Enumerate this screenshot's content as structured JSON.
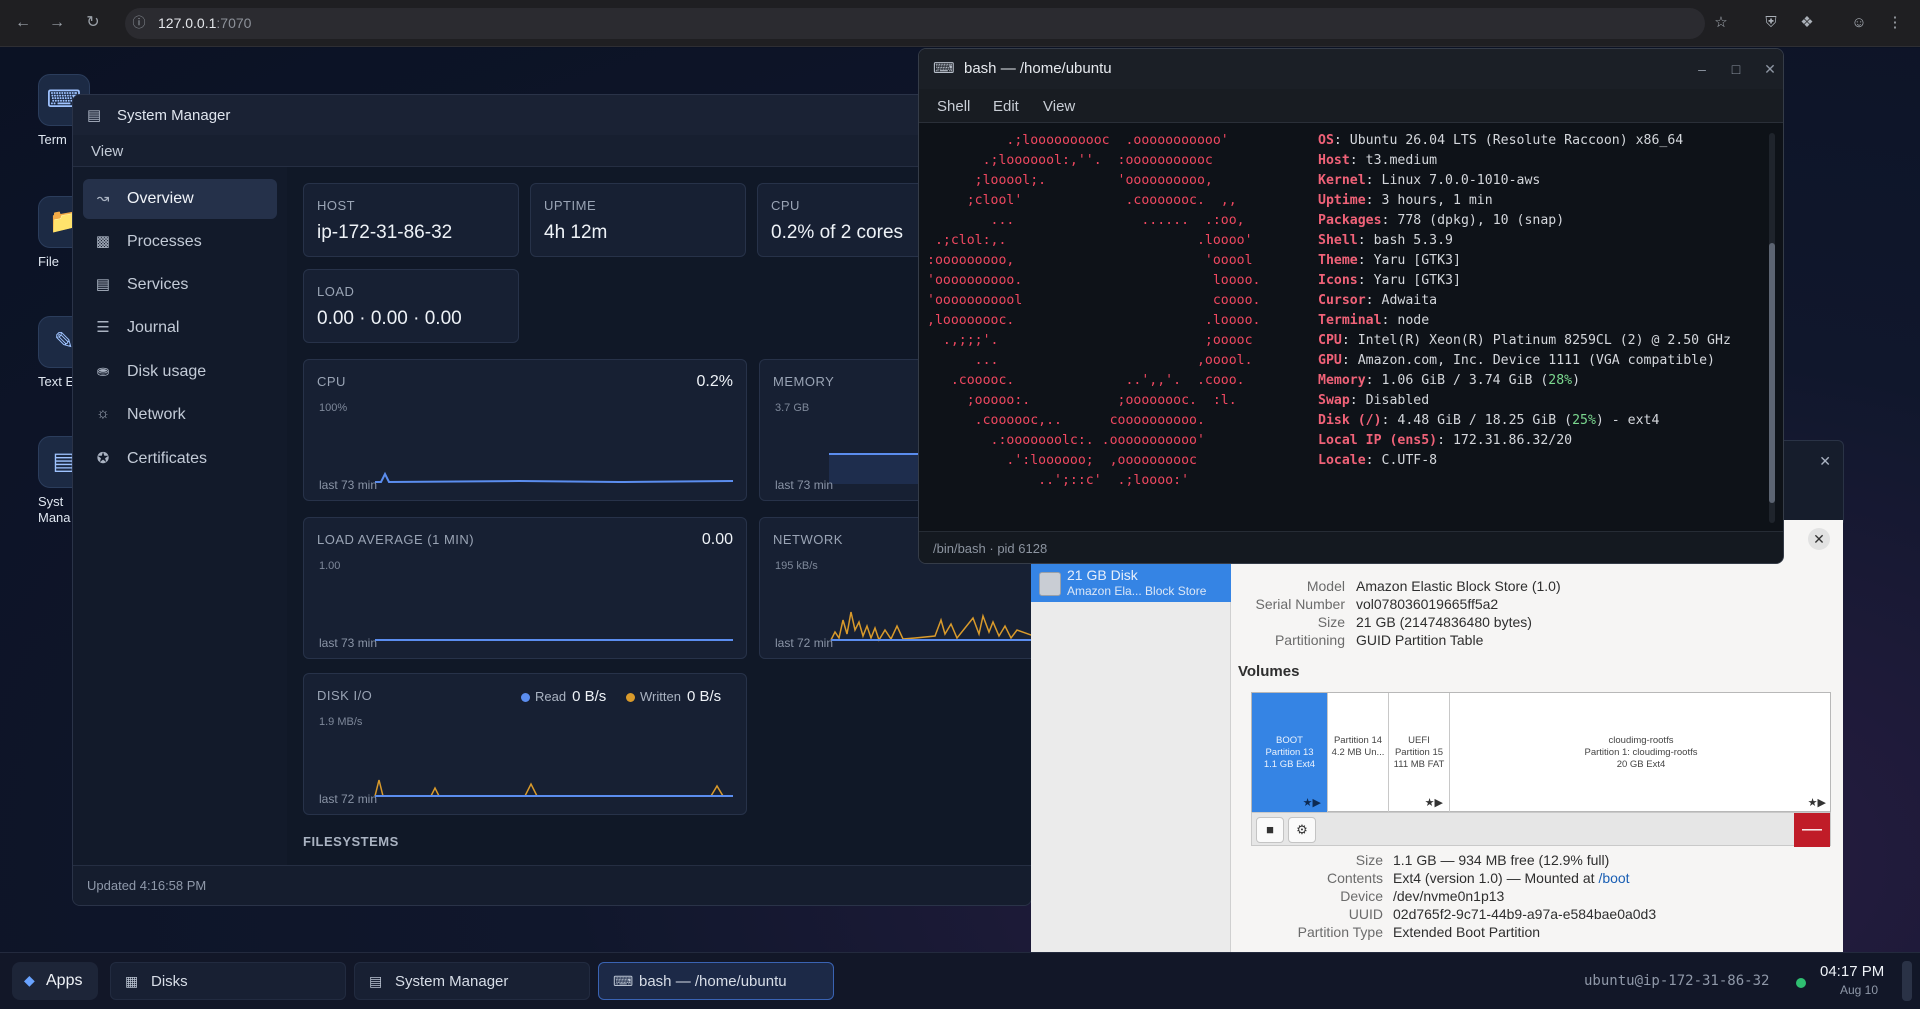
{
  "browser": {
    "url_host": "127.0.0.1",
    "url_port": ":7070",
    "back_icon": "arrow-left-icon",
    "forward_icon": "arrow-right-icon",
    "reload_icon": "reload-icon",
    "info_icon": "info-circle-icon"
  },
  "desktop": {
    "icons": [
      {
        "label": "Term",
        "icon": "terminal-icon"
      },
      {
        "label": "File",
        "icon": "folder-icon"
      },
      {
        "label": "Text E",
        "icon": "text-editor-icon"
      },
      {
        "label": "Syst\nMana",
        "icon": "system-manager-icon"
      }
    ]
  },
  "system_manager": {
    "title": "System Manager",
    "menu_view": "View",
    "sidebar": [
      {
        "label": "Overview",
        "icon": "chart-line-icon",
        "active": true
      },
      {
        "label": "Processes",
        "icon": "cpu-chip-icon",
        "active": false
      },
      {
        "label": "Services",
        "icon": "server-icon",
        "active": false
      },
      {
        "label": "Journal",
        "icon": "journal-icon",
        "active": false
      },
      {
        "label": "Disk usage",
        "icon": "database-icon",
        "active": false
      },
      {
        "label": "Network",
        "icon": "globe-icon",
        "active": false
      },
      {
        "label": "Certificates",
        "icon": "certificate-icon",
        "active": false
      }
    ],
    "summary": {
      "host_label": "HOST",
      "host_value": "ip-172-31-86-32",
      "uptime_label": "UPTIME",
      "uptime_value": "4h 12m",
      "cpu_label": "CPU",
      "cpu_value": "0.2% of 2 cores",
      "load_label": "LOAD",
      "load_value": "0.00 · 0.00 · 0.00"
    },
    "charts": {
      "cpu": {
        "label": "CPU",
        "value": "0.2%",
        "scale": "100%",
        "footer": "last 73 min"
      },
      "memory": {
        "label": "MEMORY",
        "scale": "3.7 GB",
        "footer": "last 73 min"
      },
      "load_avg": {
        "label": "LOAD AVERAGE (1 MIN)",
        "value": "0.00",
        "scale": "1.00",
        "footer": "last 73 min"
      },
      "network": {
        "label": "NETWORK",
        "scale": "195 kB/s",
        "footer": "last 72 min"
      },
      "disk_io": {
        "label": "DISK I/O",
        "scale": "1.9 MB/s",
        "footer": "last 72 min",
        "read_label": "Read",
        "read_value": "0 B/s",
        "written_label": "Written",
        "written_value": "0 B/s",
        "read_color": "#5b8def",
        "written_color": "#d99a2b"
      }
    },
    "filesystems_label": "FILESYSTEMS",
    "status": "Updated 4:16:58 PM",
    "accent": "#5b8def"
  },
  "terminal": {
    "title": "bash — /home/ubuntu",
    "menu": [
      "Shell",
      "Edit",
      "View"
    ],
    "ascii_art": "          .;loooooooooc  .ooooooooooo'\n       .;looooool:,''.  :ooooooooooc\n      ;looool;.         'oooooooooo,\n     ;clool'             .cooooooc.  ,,\n        ...                ......  .:oo,\n .;clol:,.                        .loooo'\n:ooooooooo,                        'ooool\n'oooooooooo.                        loooo.\n'ooooooooool                        coooo.\n,loooooooc.                        .loooo.\n  .,;;;'.                          ;ooooc\n      ...                         ,ooool.\n   .cooooc.              ..',,'.  .cooo.\n     ;ooooo:.           ;oooooooc.  :l.\n      .coooooc,..      coooooooooo.\n        .:ooooooolc:. .ooooooooooo'\n          .':loooooo;  ,oooooooooc\n              ..';::c'  .;loooo:'",
    "info": [
      {
        "k": "OS",
        "v": "Ubuntu 26.04 LTS (Resolute Raccoon) x86_64"
      },
      {
        "k": "Host",
        "v": "t3.medium"
      },
      {
        "k": "Kernel",
        "v": "Linux 7.0.0-1010-aws"
      },
      {
        "k": "Uptime",
        "v": "3 hours, 1 min"
      },
      {
        "k": "Packages",
        "v": "778 (dpkg), 10 (snap)"
      },
      {
        "k": "Shell",
        "v": "bash 5.3.9"
      },
      {
        "k": "Theme",
        "v": "Yaru [GTK3]"
      },
      {
        "k": "Icons",
        "v": "Yaru [GTK3]"
      },
      {
        "k": "Cursor",
        "v": "Adwaita"
      },
      {
        "k": "Terminal",
        "v": "node"
      },
      {
        "k": "CPU",
        "v": "Intel(R) Xeon(R) Platinum 8259CL (2) @ 2.50 GHz"
      },
      {
        "k": "GPU",
        "v": "Amazon.com, Inc. Device 1111 (VGA compatible)"
      },
      {
        "k": "Memory",
        "v": "1.06 GiB / 3.74 GiB (",
        "pct": "28%",
        "tail": ")"
      },
      {
        "k": "Swap",
        "v": "Disabled"
      },
      {
        "k": "Disk (/)",
        "v": "4.48 GiB / 18.25 GiB (",
        "pct": "25%",
        "tail": ") - ext4"
      },
      {
        "k": "Local IP (ens5)",
        "v": "172.31.86.32/20"
      },
      {
        "k": "Locale",
        "v": "C.UTF-8"
      }
    ],
    "palette_top": [
      "#1b1f27",
      "#f0707f",
      "#8fd17a",
      "#f2b366",
      "#6f9cf2",
      "#c28ff0",
      "#64c8f2",
      "#c7d0e8"
    ],
    "palette_bottom": [
      "#4a5a80",
      "#ff8796",
      "#b6eb9a",
      "#ffd08a",
      "#93b6ff",
      "#d9b2ff",
      "#9fdcff",
      "#eef1f8"
    ],
    "status": "/bin/bash · pid 6128"
  },
  "disks": {
    "disk_name": "21 GB Disk",
    "disk_sub": "Amazon Ela...  Block Store",
    "fields": [
      {
        "k": "Model",
        "v": "Amazon Elastic Block Store (1.0)"
      },
      {
        "k": "Serial Number",
        "v": "vol078036019665ff5a2"
      },
      {
        "k": "Size",
        "v": "21 GB (21474836480 bytes)"
      },
      {
        "k": "Partitioning",
        "v": "GUID Partition Table"
      }
    ],
    "volumes_label": "Volumes",
    "partitions": [
      {
        "lines": "BOOT\nPartition 13\n1.1 GB Ext4",
        "selected": true
      },
      {
        "lines": "Partition 14\n4.2 MB Un...",
        "selected": false
      },
      {
        "lines": "UEFI\nPartition 15\n111 MB FAT",
        "selected": false
      },
      {
        "lines": "cloudimg-rootfs\nPartition 1: cloudimg-rootfs\n20 GB Ext4",
        "selected": false
      }
    ],
    "volume_fields": [
      {
        "k": "Size",
        "v": "1.1 GB — 934 MB free (12.9% full)"
      },
      {
        "k": "Contents",
        "v": "Ext4 (version 1.0) — Mounted at ",
        "link": "/boot"
      },
      {
        "k": "Device",
        "v": "/dev/nvme0n1p13"
      },
      {
        "k": "UUID",
        "v": "02d765f2-9c71-44b9-a97a-e584bae0a0d3"
      },
      {
        "k": "Partition Type",
        "v": "Extended Boot Partition"
      }
    ]
  },
  "taskbar": {
    "apps_label": "Apps",
    "items": [
      {
        "label": "Disks",
        "icon": "disks-icon",
        "active": false
      },
      {
        "label": "System Manager",
        "icon": "system-manager-icon",
        "active": false
      },
      {
        "label": "bash — /home/ubuntu",
        "icon": "terminal-icon",
        "active": true
      }
    ],
    "user": "ubuntu@ip-172-31-86-32",
    "time": "04:17 PM",
    "date": "Aug 10"
  }
}
